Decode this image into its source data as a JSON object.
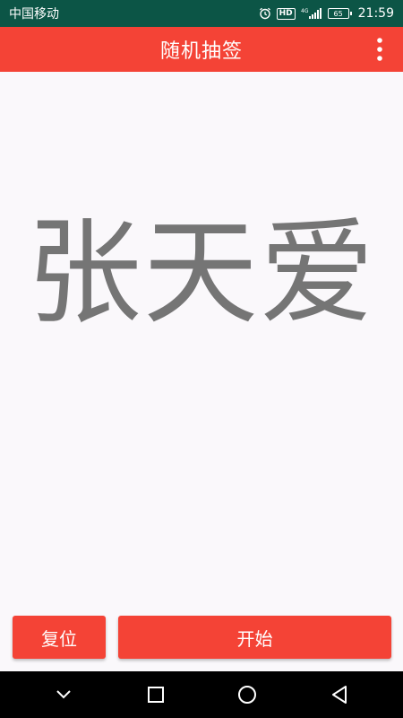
{
  "status_bar": {
    "carrier": "中国移动",
    "network": "4G",
    "battery": "65",
    "time": "21:59",
    "hd_label": "HD"
  },
  "app_bar": {
    "title": "随机抽签"
  },
  "main": {
    "drawn_name": "张天爱"
  },
  "buttons": {
    "reset_label": "复位",
    "start_label": "开始"
  },
  "colors": {
    "accent": "#f44336",
    "status_bar": "#0c5546",
    "name_text": "#757575"
  }
}
